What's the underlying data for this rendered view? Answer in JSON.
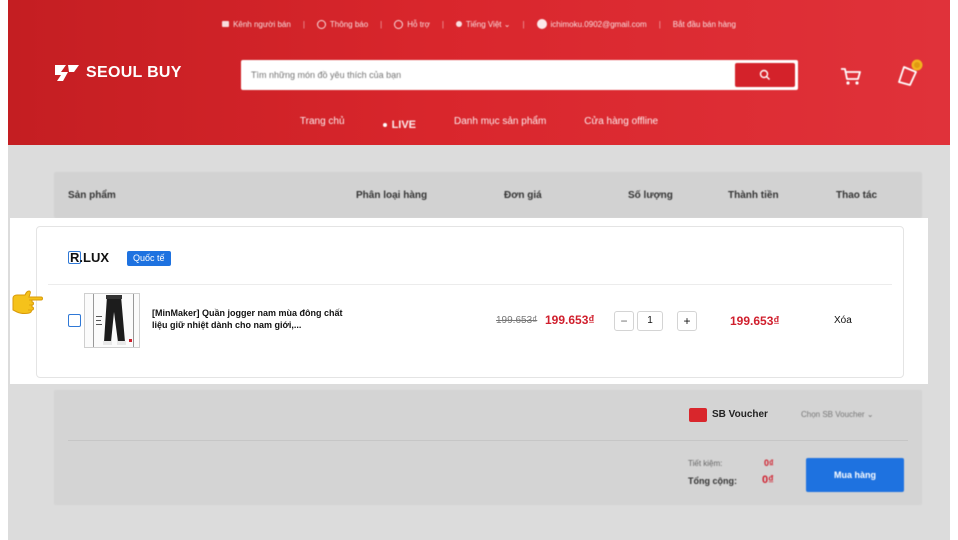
{
  "topbar": {
    "items": [
      {
        "icon": "seller-channel-icon",
        "label": "Kênh người bán"
      },
      {
        "icon": "bell-icon",
        "label": "Thông báo"
      },
      {
        "icon": "headset-icon",
        "label": "Hỗ trợ"
      },
      {
        "icon": "globe-icon",
        "label": "Tiếng Việt ⌄"
      },
      {
        "icon": "user-avatar-icon",
        "label": "ichimoku.0902@gmail.com"
      },
      {
        "icon": "",
        "label": "Bắt đầu bán hàng"
      }
    ]
  },
  "brand": {
    "logo_text": "SEOUL BUY",
    "color": "#d9262c"
  },
  "search": {
    "placeholder": "Tìm những món đồ yêu thích của bạn"
  },
  "nav": {
    "home": "Trang chủ",
    "live": "LIVE",
    "categories": "Danh mục sản phẩm",
    "offline": "Cửa hàng offline"
  },
  "table_header": {
    "product": "Sản phẩm",
    "variant": "Phân loại hàng",
    "unit_price": "Đơn giá",
    "quantity": "Số lượng",
    "total": "Thành tiền",
    "actions": "Thao tác"
  },
  "shop": {
    "name": "R.LUX",
    "badge": "Quốc tế",
    "item": {
      "name": "[MinMaker] Quần jogger nam mùa đông chất liệu giữ nhiệt dành cho nam giới,...",
      "price_old": "199.653₫",
      "price_new": "199.653₫",
      "qty_minus": "−",
      "qty": "1",
      "qty_plus": "+",
      "line_total": "199.653₫",
      "delete": "Xóa"
    }
  },
  "summary": {
    "voucher_label": "SB Voucher",
    "voucher_select": "Chọn SB Voucher ⌄",
    "savings_label": "Tiết kiệm:",
    "savings_value": "0₫",
    "total_label": "Tổng cộng:",
    "total_value": "0₫",
    "buy_button": "Mua hàng"
  },
  "colors": {
    "accent_red": "#d01f2d",
    "accent_blue": "#1e72e0",
    "pointer_yellow": "#f5c21b"
  }
}
